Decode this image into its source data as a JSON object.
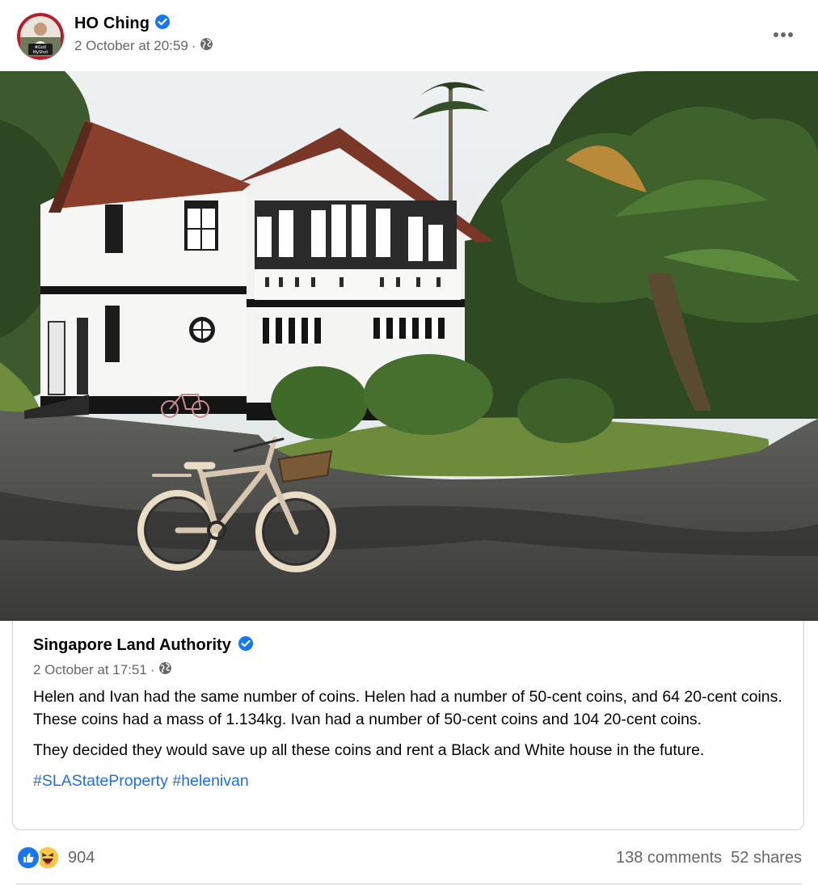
{
  "post": {
    "author": "HO Ching",
    "verified": true,
    "timestamp": "2 October at 20:59",
    "separator": "·",
    "privacy_icon": "globe-icon",
    "more_icon": "more-horizontal-icon",
    "avatar_text": "#GotMyShot"
  },
  "shared": {
    "author": "Singapore Land Authority",
    "verified": true,
    "timestamp": "2 October at 17:51",
    "separator": "·",
    "privacy_icon": "globe-icon",
    "paragraph1": "Helen and Ivan had the same number of coins. Helen had a number of 50-cent coins, and 64 20-cent coins. These coins had a mass of 1.134kg. Ivan had a number of 50-cent coins and 104 20-cent coins.",
    "paragraph2": "They decided they would save up all these coins and rent a Black and White house in the future.",
    "hashtags": [
      "#SLAStateProperty",
      "#helenivan"
    ]
  },
  "footer": {
    "reaction_icons": [
      "like-icon",
      "haha-icon"
    ],
    "reaction_count": "904",
    "comments": "138 comments",
    "shares": "52 shares"
  },
  "colors": {
    "verified_blue": "#1877f2",
    "link_blue": "#216fdb",
    "meta_grey": "#65676b"
  }
}
